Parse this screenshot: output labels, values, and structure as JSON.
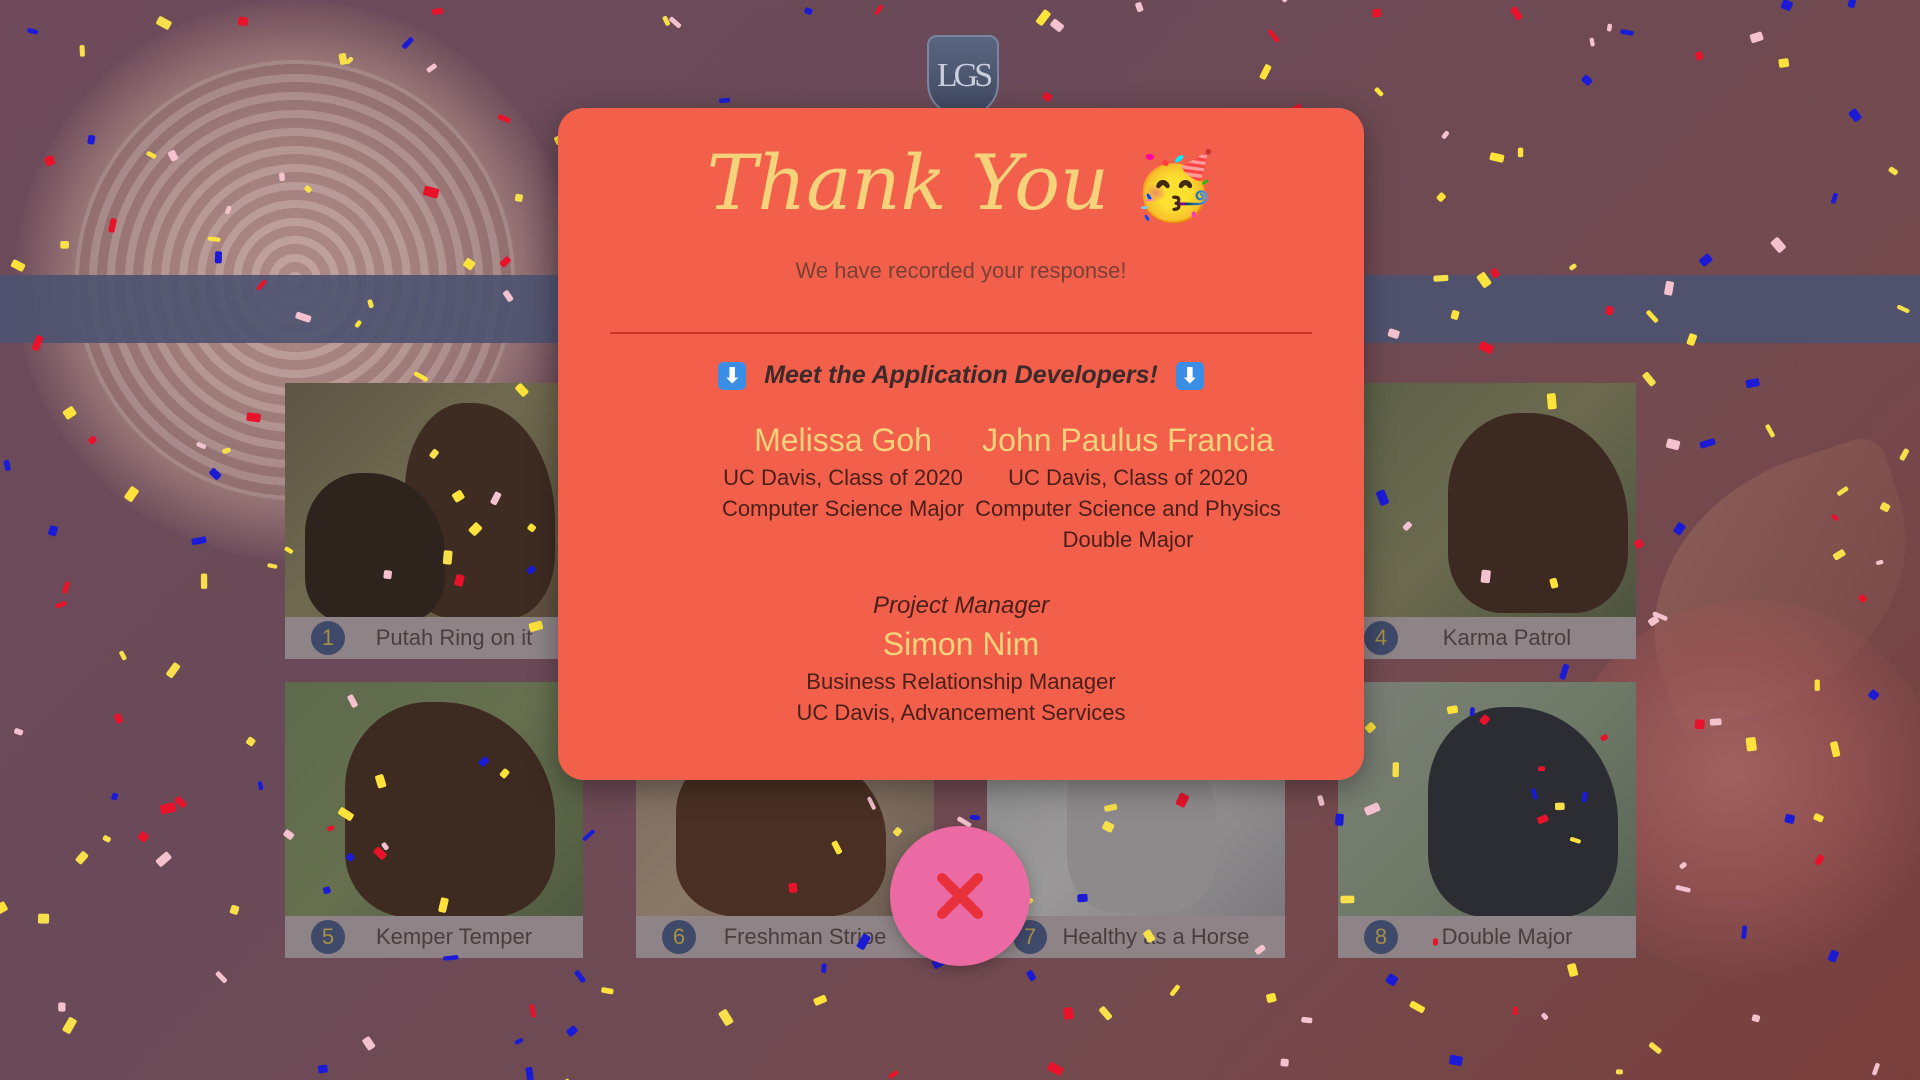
{
  "header": {
    "logo_text": "LGS"
  },
  "gallery": {
    "cards": [
      {
        "number": "1",
        "name": "Putah Ring on it"
      },
      {
        "number": "4",
        "name": "Karma Patrol"
      },
      {
        "number": "5",
        "name": "Kemper Temper"
      },
      {
        "number": "6",
        "name": "Freshman Stripe"
      },
      {
        "number": "7",
        "name": "Healthy as a Horse"
      },
      {
        "number": "8",
        "name": "Double Major"
      }
    ]
  },
  "modal": {
    "title": "Thank You",
    "title_emoji": "🥳",
    "subtitle": "We have recorded your response!",
    "meet_heading": "Meet the Application Developers!",
    "arrow_glyph": "⬇",
    "developers": [
      {
        "name": "Melissa Goh",
        "lines": [
          "UC Davis, Class of 2020",
          "Computer Science Major"
        ]
      },
      {
        "name": "John Paulus Francia",
        "lines": [
          "UC Davis, Class of 2020",
          "Computer Science and Physics",
          "Double Major"
        ]
      }
    ],
    "project_manager": {
      "role": "Project Manager",
      "name": "Simon Nim",
      "lines": [
        "Business Relationship Manager",
        "UC Davis, Advancement Services"
      ]
    }
  },
  "close_button": {
    "icon": "close-x-icon",
    "color": "#e8303a"
  },
  "colors": {
    "modal_bg": "#f2604c",
    "accent_gold": "#f6d27a",
    "close_button_bg": "#ec6aa3",
    "band": "#4d5270"
  }
}
